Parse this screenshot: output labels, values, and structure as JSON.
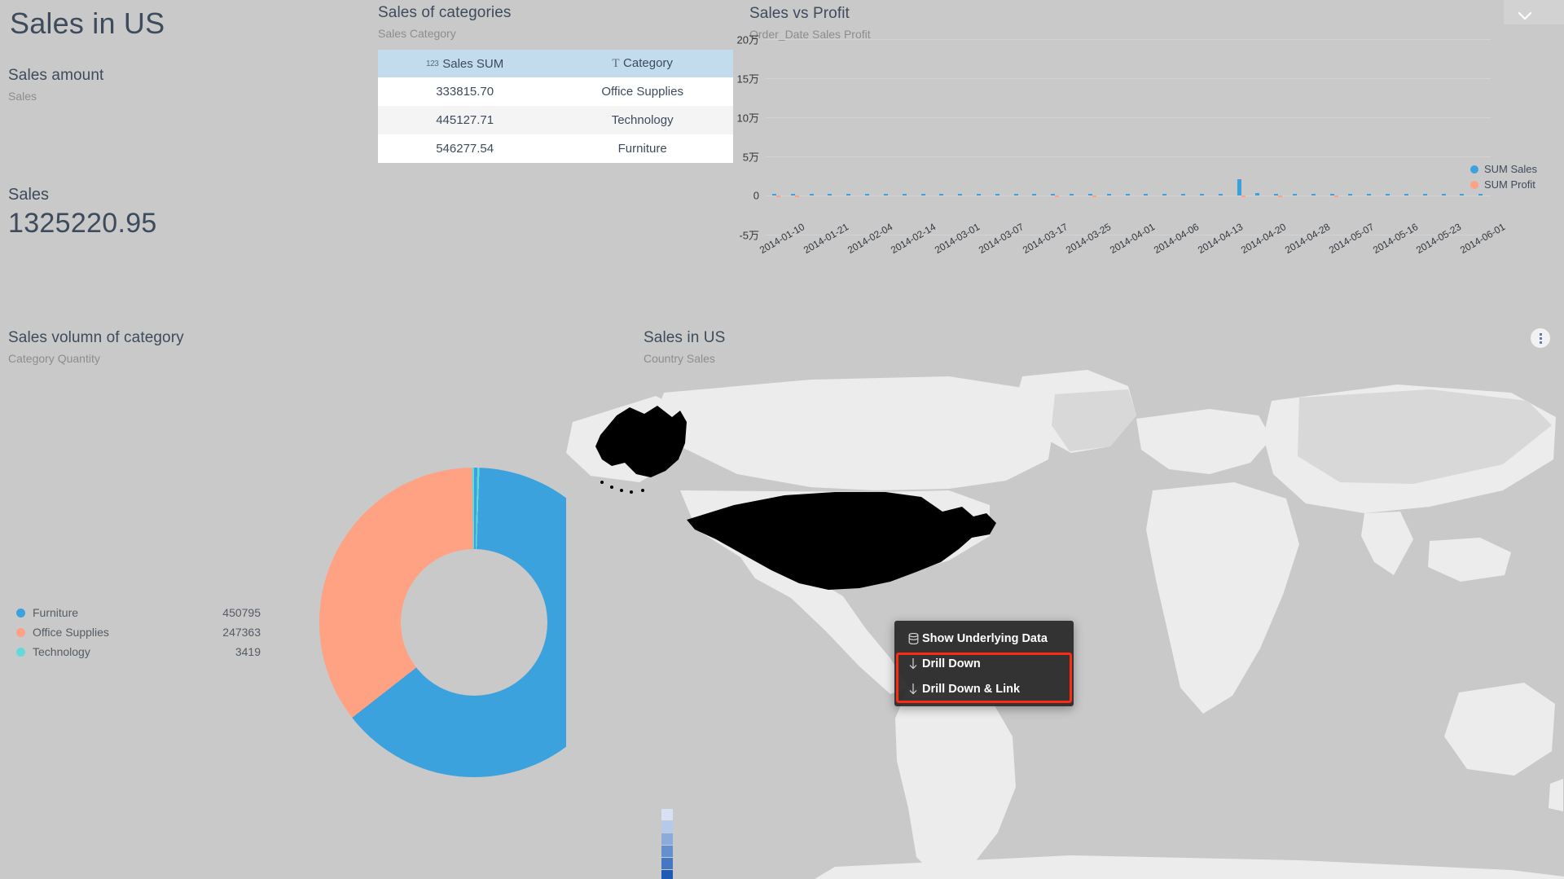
{
  "page": {
    "title": "Sales in US",
    "background": "#c9c9c9"
  },
  "topbar": {
    "collapse_icon": "chevron-down-icon"
  },
  "kpi": {
    "title": "Sales amount",
    "subtitle": "Sales",
    "value_label": "Sales",
    "value": "1325220.95"
  },
  "category_table": {
    "title": "Sales of categories",
    "subtitle": "Sales Category",
    "columns": [
      {
        "label": "Sales  SUM",
        "icon": "123",
        "icon_name": "number-type-icon"
      },
      {
        "label": "Category",
        "icon": "T",
        "icon_name": "text-type-icon"
      }
    ],
    "rows": [
      {
        "sales": "333815.70",
        "category": "Office Supplies"
      },
      {
        "sales": "445127.71",
        "category": "Technology"
      },
      {
        "sales": "546277.54",
        "category": "Furniture"
      }
    ]
  },
  "timeseries": {
    "title": "Sales vs Profit",
    "subtitle": "Order_Date Sales Profit",
    "legend": [
      {
        "label": "SUM Sales",
        "color": "#3ba2dd"
      },
      {
        "label": "SUM Profit",
        "color": "#ffa183"
      }
    ],
    "kebab_icon": "more-options-icon"
  },
  "donut": {
    "title": "Sales volumn of category",
    "subtitle": "Category Quantity",
    "legend": [
      {
        "label": "Furniture",
        "value": "450795",
        "color": "#3ba2dd"
      },
      {
        "label": "Office Supplies",
        "value": "247363",
        "color": "#ffa183"
      },
      {
        "label": "Technology",
        "value": "3419",
        "color": "#65d9d9"
      }
    ]
  },
  "map": {
    "title": "Sales in US",
    "subtitle": "Country Sales",
    "highlighted_region": "United States",
    "scale_colors": [
      "#d7e1f3",
      "#b5c9ea",
      "#8cabdd",
      "#6590cf",
      "#4478c4",
      "#1f5bb5"
    ]
  },
  "context_menu": {
    "items": [
      {
        "label": "Show Underlying Data",
        "icon": "database-icon",
        "highlighted": false
      },
      {
        "label": "Drill Down",
        "icon": "arrow-down-icon",
        "highlighted": true
      },
      {
        "label": "Drill Down & Link",
        "icon": "arrow-down-icon",
        "highlighted": true
      }
    ],
    "highlight_color": "#fd2b11"
  },
  "chart_data": [
    {
      "type": "bar",
      "title": "Sales vs Profit",
      "subtitle": "Order_Date Sales Profit",
      "xlabel": "Order_Date",
      "ylabel": "",
      "ylim": [
        -50000,
        200000
      ],
      "ytick_labels": [
        "20万",
        "15万",
        "10万",
        "5万",
        "0",
        "-5万"
      ],
      "ytick_values": [
        200000,
        150000,
        100000,
        50000,
        0,
        -50000
      ],
      "grid": true,
      "legend_position": "right",
      "xtick_labels": [
        "2014-01-10",
        "2014-01-21",
        "2014-02-04",
        "2014-02-14",
        "2014-03-01",
        "2014-03-07",
        "2014-03-17",
        "2014-03-25",
        "2014-04-01",
        "2014-04-06",
        "2014-04-13",
        "2014-04-20",
        "2014-04-28",
        "2014-05-07",
        "2014-05-16",
        "2014-05-23",
        "2014-06-01"
      ],
      "series": [
        {
          "name": "SUM Sales",
          "color": "#3ba2dd",
          "values": [
            2600,
            600,
            200,
            100,
            300,
            200,
            150,
            100,
            400,
            200,
            900,
            200,
            1500,
            300,
            1200,
            400,
            800,
            300,
            1100,
            600,
            200,
            900,
            400,
            700,
            300,
            20500,
            2800,
            900,
            500,
            700,
            400,
            1600,
            1200,
            1900,
            600,
            1100,
            300,
            2600,
            500
          ]
        },
        {
          "name": "SUM Profit",
          "color": "#ffa183",
          "values": [
            -900,
            -100,
            0,
            0,
            0,
            0,
            0,
            0,
            0,
            0,
            0,
            0,
            0,
            0,
            0,
            -200,
            0,
            -150,
            0,
            0,
            0,
            0,
            0,
            0,
            0,
            -1400,
            0,
            -700,
            0,
            0,
            -200,
            0,
            0,
            0,
            0,
            0,
            0,
            0,
            0
          ]
        }
      ]
    },
    {
      "type": "pie",
      "title": "Sales volumn of category",
      "subtitle": "Category Quantity",
      "labels": [
        "Furniture",
        "Office Supplies",
        "Technology"
      ],
      "values": [
        450795,
        247363,
        3419
      ],
      "colors": [
        "#3ba2dd",
        "#ffa183",
        "#65d9d9"
      ],
      "donut": true,
      "legend_position": "left"
    },
    {
      "type": "table",
      "title": "Sales of categories",
      "subtitle": "Sales Category",
      "columns": [
        "Sales  SUM",
        "Category"
      ],
      "rows": [
        [
          "333815.70",
          "Office Supplies"
        ],
        [
          "445127.71",
          "Technology"
        ],
        [
          "546277.54",
          "Furniture"
        ]
      ]
    }
  ]
}
